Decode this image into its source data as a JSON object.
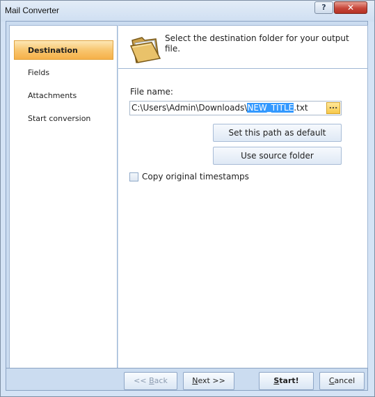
{
  "window": {
    "title": "Mail Converter",
    "help_glyph": "?",
    "close_glyph": "✕"
  },
  "sidebar": {
    "items": [
      {
        "label": "Destination",
        "active": true
      },
      {
        "label": "Fields",
        "active": false
      },
      {
        "label": "Attachments",
        "active": false
      },
      {
        "label": "Start conversion",
        "active": false
      }
    ]
  },
  "header": {
    "text": "Select the destination folder for your output file.",
    "icon": "folder-icon"
  },
  "form": {
    "file_label": "File name:",
    "file_value_prefix": "C:\\Users\\Admin\\Downloads\\",
    "file_value_selected": "NEW_TITLE",
    "file_value_suffix": ".txt",
    "browse_label": "...",
    "set_default_label": "Set this path as default",
    "use_source_label": "Use source folder",
    "copy_timestamps_label": "Copy original timestamps",
    "copy_timestamps_checked": false
  },
  "footer": {
    "back": {
      "pre": "<< ",
      "accel": "B",
      "post": "ack"
    },
    "next": {
      "accel": "N",
      "post": "ext >>"
    },
    "start": {
      "accel": "S",
      "post": "tart!"
    },
    "cancel": {
      "accel": "C",
      "post": "ancel"
    }
  },
  "colors": {
    "active_nav": "#f8c66f",
    "selection": "#3399ff",
    "frame": "#cbdcf0"
  }
}
